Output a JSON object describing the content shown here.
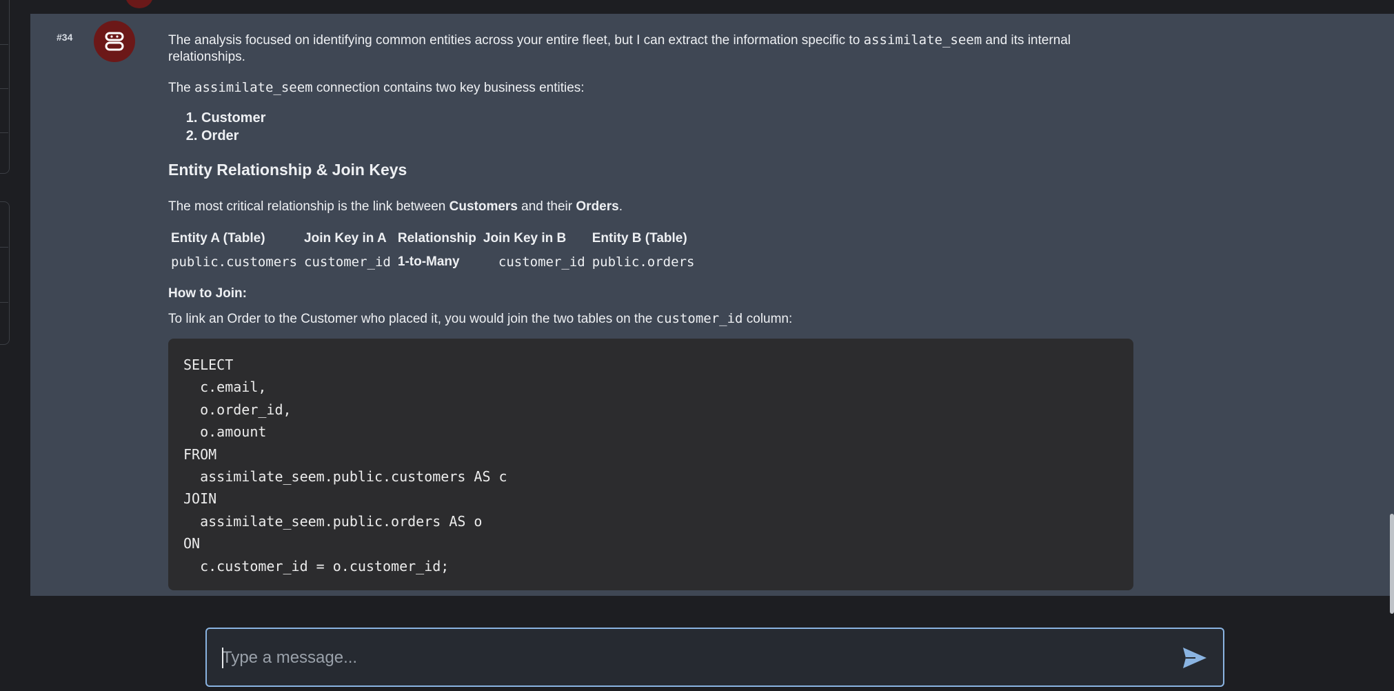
{
  "message": {
    "number": "#34",
    "intro_text": "The analysis focused on identifying common entities across your entire fleet, but I can extract the information specific to ",
    "intro_code": "assimilate_seem",
    "intro_text_end": " and its internal relationships.",
    "conn_text_a": "The ",
    "conn_code": "assimilate_seem",
    "conn_text_b": " connection contains two key business entities:",
    "entities": [
      "Customer",
      "Order"
    ],
    "section_heading": "Entity Relationship & Join Keys",
    "critical_a": "The most critical relationship is the link between ",
    "critical_customers": "Customers",
    "critical_b": " and their ",
    "critical_orders": "Orders",
    "critical_c": ".",
    "table": {
      "headers": [
        "Entity A (Table)",
        "Join Key in A",
        "Relationship",
        "Join Key in B",
        "Entity B (Table)"
      ],
      "row": [
        "public.customers",
        "customer_id",
        "1-to-Many",
        "customer_id",
        "public.orders"
      ]
    },
    "how_to_join": "How to Join:",
    "join_text_a": "To link an Order to the Customer who placed it, you would join the two tables on the ",
    "join_code": "customer_id",
    "join_text_b": " column:",
    "sql": "SELECT\n  c.email,\n  o.order_id,\n  o.amount\nFROM\n  assimilate_seem.public.customers AS c\nJOIN\n  assimilate_seem.public.orders AS o\nON\n  c.customer_id = o.customer_id;"
  },
  "composer": {
    "placeholder": "Type a message..."
  },
  "icons": {
    "avatar": "bot-icon",
    "send": "send-icon"
  },
  "colors": {
    "accent_input_border": "#8ab4e2",
    "avatar_bg": "#6c1818",
    "message_bg": "#3f4754"
  }
}
